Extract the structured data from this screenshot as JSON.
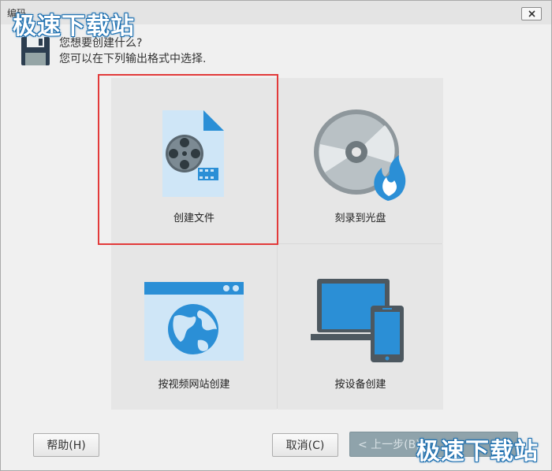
{
  "window": {
    "title": "编码"
  },
  "watermark": {
    "text": "极速下载站"
  },
  "header": {
    "question": "您想要创建什么?",
    "instruction": "您可以在下列输出格式中选择."
  },
  "tiles": [
    {
      "label": "创建文件",
      "icon": "film-file-icon",
      "selected": true
    },
    {
      "label": "刻录到光盘",
      "icon": "burn-disc-icon",
      "selected": false
    },
    {
      "label": "按视频网站创建",
      "icon": "web-globe-icon",
      "selected": false
    },
    {
      "label": "按设备创建",
      "icon": "devices-icon",
      "selected": false
    }
  ],
  "buttons": {
    "help": "帮助(H)",
    "cancel": "取消(C)",
    "back": "< 上一步(B)"
  },
  "colors": {
    "selection": "#e23a3a",
    "accent_blue": "#2b8fd6",
    "disabled_button": "#8fa3ab"
  }
}
